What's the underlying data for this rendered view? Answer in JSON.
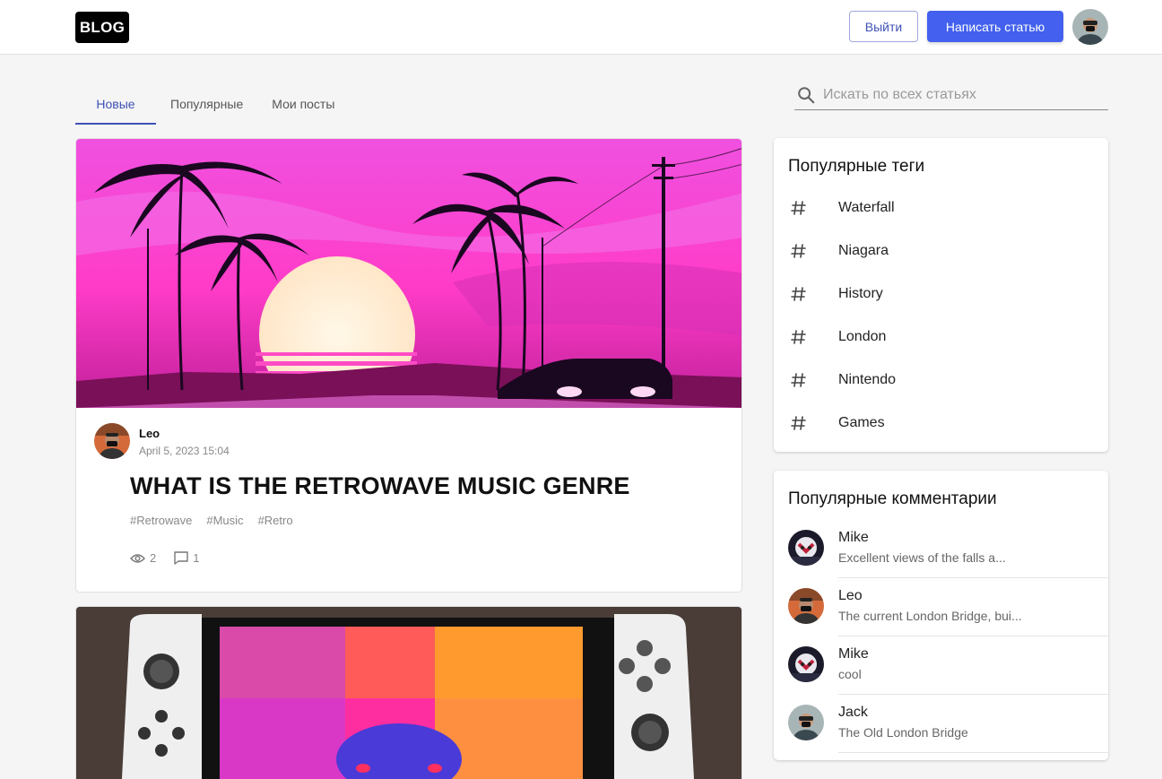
{
  "header": {
    "logo": "BLOG",
    "logout_label": "Выйти",
    "write_label": "Написать статью",
    "avatar_icon": "user-avatar-icon"
  },
  "tabs": [
    {
      "label": "Новые",
      "active": true
    },
    {
      "label": "Популярные",
      "active": false
    },
    {
      "label": "Мои посты",
      "active": false
    }
  ],
  "search": {
    "placeholder": "Искать по всех статьях",
    "value": ""
  },
  "posts": [
    {
      "image": "retrowave-sunset-palms-image",
      "author": "Leo",
      "date": "April 5, 2023 15:04",
      "title": "WHAT IS THE RETROWAVE MUSIC GENRE",
      "tags": [
        "#Retrowave",
        "#Music",
        "#Retro"
      ],
      "views": "2",
      "comments": "1"
    },
    {
      "image": "nintendo-switch-image"
    }
  ],
  "tags_card": {
    "title": "Популярные теги",
    "items": [
      "Waterfall",
      "Niagara",
      "History",
      "London",
      "Nintendo",
      "Games"
    ]
  },
  "comments_card": {
    "title": "Популярные комментарии",
    "items": [
      {
        "name": "Mike",
        "text": "Excellent views of the falls a..."
      },
      {
        "name": "Leo",
        "text": "The current London Bridge, bui..."
      },
      {
        "name": "Mike",
        "text": "cool"
      },
      {
        "name": "Jack",
        "text": "The Old London Bridge"
      }
    ]
  },
  "colors": {
    "accent": "#4361ee",
    "tab_active": "#3f51b5",
    "background": "#f5f5f5"
  }
}
